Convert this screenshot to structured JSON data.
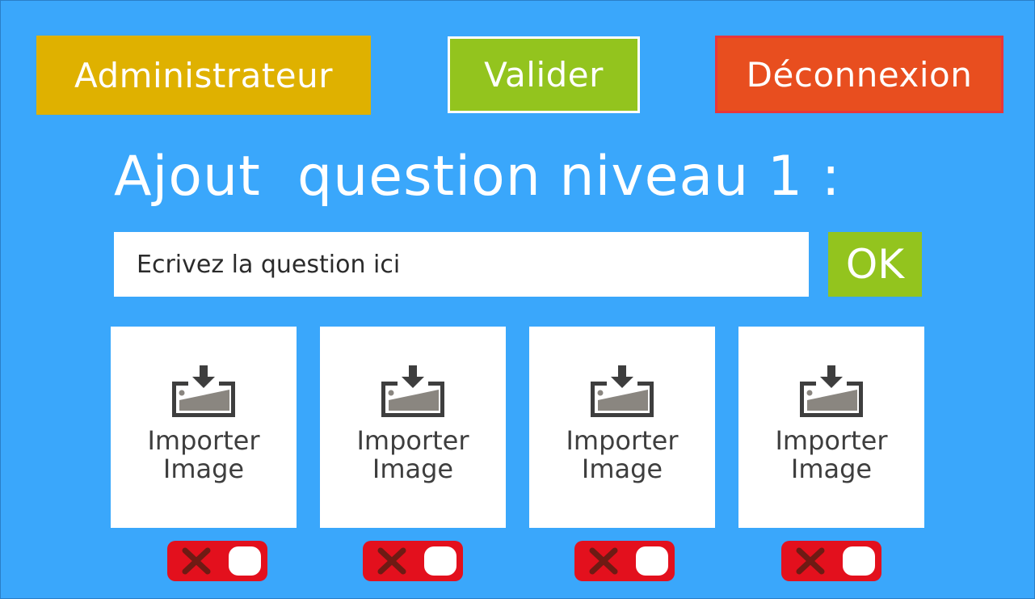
{
  "header": {
    "admin_label": "Administrateur",
    "validate_label": "Valider",
    "logout_label": "Déconnexion"
  },
  "page_title": "Ajout  question niveau 1 :",
  "question_input": {
    "placeholder": "Ecrivez la question ici",
    "value": ""
  },
  "ok_label": "OK",
  "image_slots": [
    {
      "line1": "Importer",
      "line2": "Image",
      "icon": "image-import-icon",
      "toggle_state": "off"
    },
    {
      "line1": "Importer",
      "line2": "Image",
      "icon": "image-import-icon",
      "toggle_state": "off"
    },
    {
      "line1": "Importer",
      "line2": "Image",
      "icon": "image-import-icon",
      "toggle_state": "off"
    },
    {
      "line1": "Importer",
      "line2": "Image",
      "icon": "image-import-icon",
      "toggle_state": "off"
    }
  ],
  "colors": {
    "background": "#3aa7fb",
    "admin": "#dfb100",
    "validate": "#93c41e",
    "logout": "#e84e1f",
    "toggle_off": "#e3101d"
  }
}
